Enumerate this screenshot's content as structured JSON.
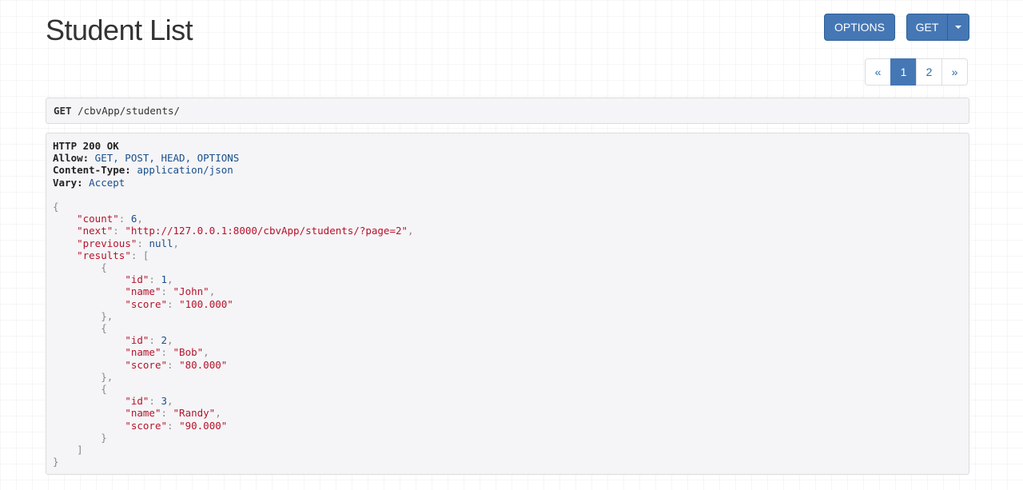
{
  "header": {
    "title": "Student List",
    "options_label": "OPTIONS",
    "get_label": "GET"
  },
  "pagination": {
    "prev": "«",
    "pages": [
      "1",
      "2"
    ],
    "active": "1",
    "next": "»"
  },
  "request": {
    "method": "GET",
    "path": " /cbvApp/students/"
  },
  "response": {
    "status": "HTTP 200 OK",
    "headers": [
      {
        "name": "Allow:",
        "value": " GET, POST, HEAD, OPTIONS"
      },
      {
        "name": "Content-Type:",
        "value": " application/json"
      },
      {
        "name": "Vary:",
        "value": " Accept"
      }
    ],
    "body": {
      "count_key": "\"count\"",
      "count_val": "6",
      "next_key": "\"next\"",
      "next_val": "\"http://127.0.0.1:8000/cbvApp/students/?page=2\"",
      "previous_key": "\"previous\"",
      "previous_val": "null",
      "results_key": "\"results\"",
      "results": [
        {
          "id": "1",
          "name": "\"John\"",
          "score": "\"100.000\""
        },
        {
          "id": "2",
          "name": "\"Bob\"",
          "score": "\"80.000\""
        },
        {
          "id": "3",
          "name": "\"Randy\"",
          "score": "\"90.000\""
        }
      ],
      "id_key": "\"id\"",
      "name_key": "\"name\"",
      "score_key": "\"score\""
    }
  },
  "colors": {
    "primary": "#4577b5",
    "json_key": "#b5132b",
    "json_value": "#1a4e8a"
  }
}
